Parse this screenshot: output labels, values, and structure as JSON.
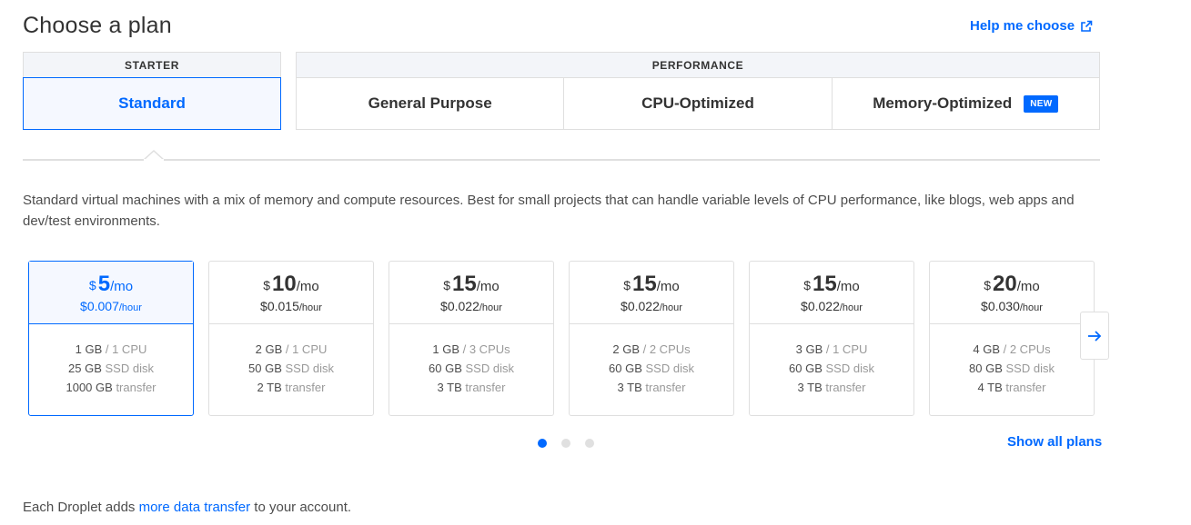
{
  "header": {
    "title": "Choose a plan",
    "help_link": "Help me choose"
  },
  "groups": {
    "starter": {
      "label": "STARTER",
      "tabs": [
        {
          "label": "Standard",
          "active": true
        }
      ]
    },
    "performance": {
      "label": "PERFORMANCE",
      "tabs": [
        {
          "label": "General Purpose"
        },
        {
          "label": "CPU-Optimized"
        },
        {
          "label": "Memory-Optimized",
          "badge": "NEW"
        }
      ]
    }
  },
  "description": "Standard virtual machines with a mix of memory and compute resources. Best for small projects that can handle variable levels of CPU performance, like blogs, web apps and dev/test environments.",
  "plans": [
    {
      "currency": "$",
      "price": "5",
      "per": "/mo",
      "hourly": "$0.007",
      "hourly_unit": "/hour",
      "mem": "1 GB",
      "cpu": "/ 1 CPU",
      "disk": "25 GB",
      "disk_label": "SSD disk",
      "transfer": "1000 GB",
      "transfer_label": "transfer",
      "selected": true
    },
    {
      "currency": "$",
      "price": "10",
      "per": "/mo",
      "hourly": "$0.015",
      "hourly_unit": "/hour",
      "mem": "2 GB",
      "cpu": "/ 1 CPU",
      "disk": "50 GB",
      "disk_label": "SSD disk",
      "transfer": "2 TB",
      "transfer_label": "transfer"
    },
    {
      "currency": "$",
      "price": "15",
      "per": "/mo",
      "hourly": "$0.022",
      "hourly_unit": "/hour",
      "mem": "1 GB",
      "cpu": "/ 3 CPUs",
      "disk": "60 GB",
      "disk_label": "SSD disk",
      "transfer": "3 TB",
      "transfer_label": "transfer"
    },
    {
      "currency": "$",
      "price": "15",
      "per": "/mo",
      "hourly": "$0.022",
      "hourly_unit": "/hour",
      "mem": "2 GB",
      "cpu": "/ 2 CPUs",
      "disk": "60 GB",
      "disk_label": "SSD disk",
      "transfer": "3 TB",
      "transfer_label": "transfer"
    },
    {
      "currency": "$",
      "price": "15",
      "per": "/mo",
      "hourly": "$0.022",
      "hourly_unit": "/hour",
      "mem": "3 GB",
      "cpu": "/ 1 CPU",
      "disk": "60 GB",
      "disk_label": "SSD disk",
      "transfer": "3 TB",
      "transfer_label": "transfer"
    },
    {
      "currency": "$",
      "price": "20",
      "per": "/mo",
      "hourly": "$0.030",
      "hourly_unit": "/hour",
      "mem": "4 GB",
      "cpu": "/ 2 CPUs",
      "disk": "80 GB",
      "disk_label": "SSD disk",
      "transfer": "4 TB",
      "transfer_label": "transfer"
    }
  ],
  "pagination": {
    "pages": 3,
    "active": 0
  },
  "show_all": "Show all plans",
  "footer": {
    "prefix": "Each Droplet adds ",
    "link": "more data transfer",
    "suffix": " to your account."
  },
  "colors": {
    "accent": "#0069ff",
    "border": "#dfdfdf",
    "header_bg": "#f3f5f9",
    "selected_bg": "#f5f8ff"
  },
  "icons": {
    "help": "external-link-icon",
    "next": "arrow-right-icon"
  }
}
